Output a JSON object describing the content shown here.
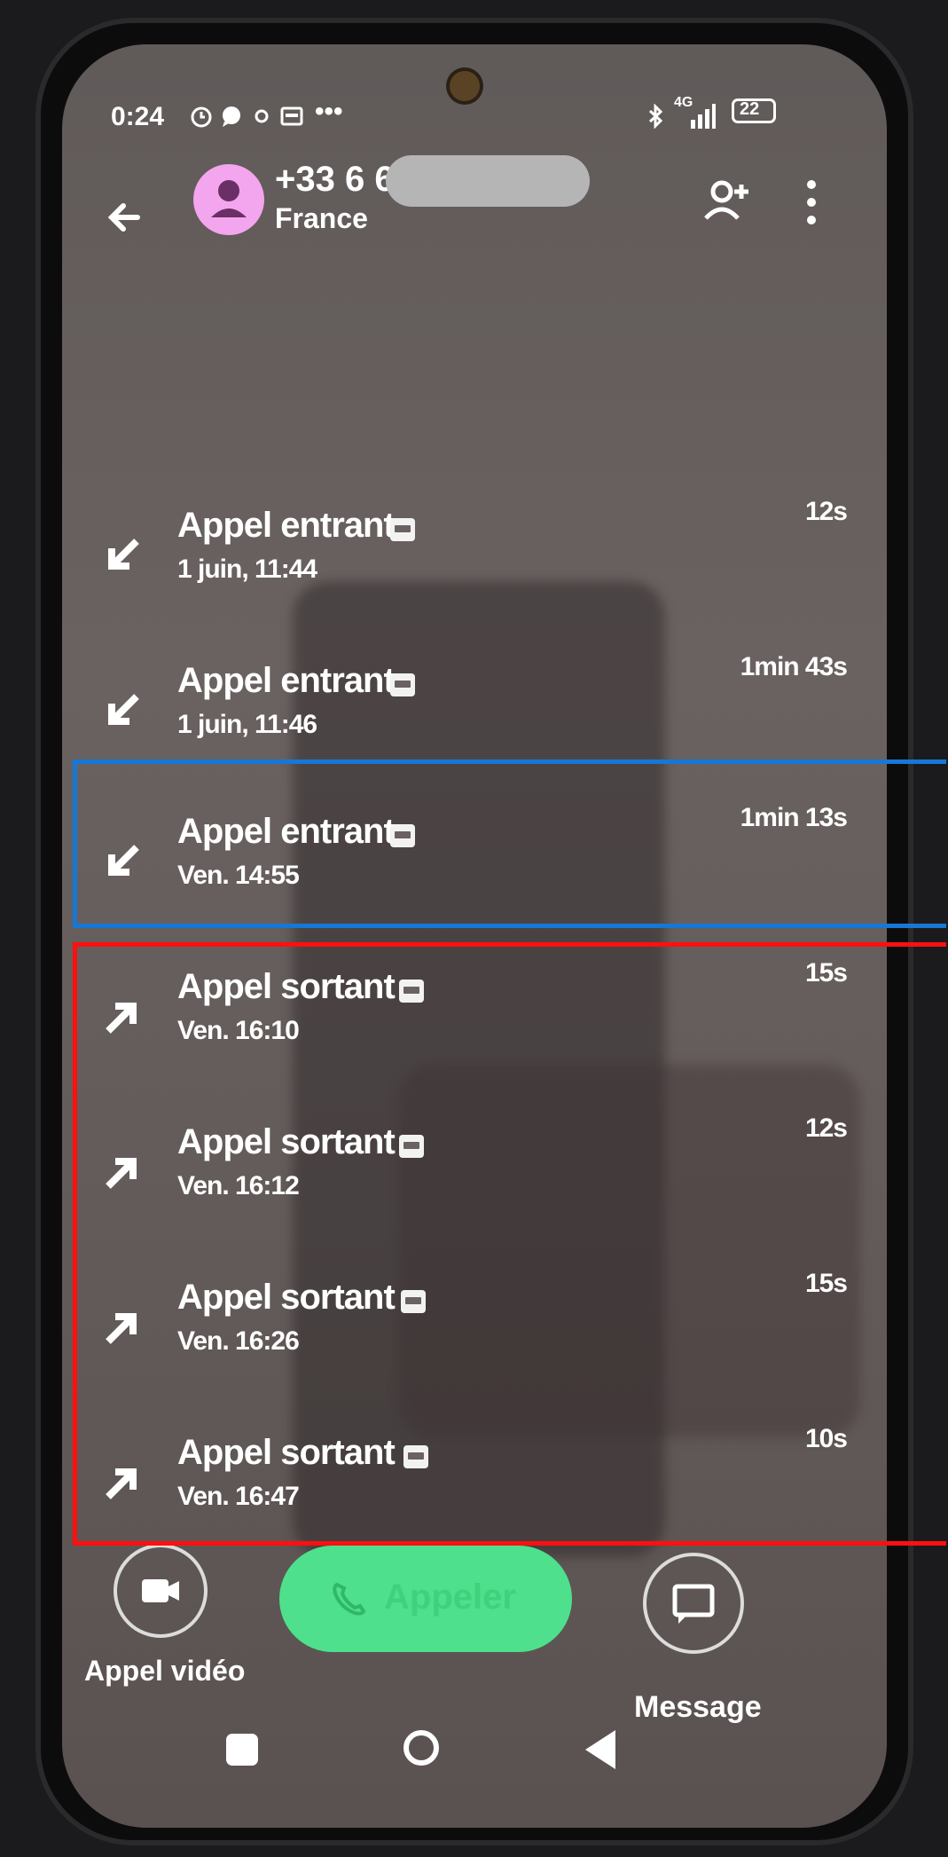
{
  "status_bar": {
    "time": "0:24",
    "extra": "•••",
    "network": "4G",
    "battery": "22"
  },
  "header": {
    "number": "+33 6 6",
    "country": "France"
  },
  "calls": [
    {
      "type": "Appel entrant",
      "time": "1 juin, 11:44",
      "duration": "12s",
      "direction": "incoming"
    },
    {
      "type": "Appel entrant",
      "time": "1 juin, 11:46",
      "duration": "1min 43s",
      "direction": "incoming"
    },
    {
      "type": "Appel entrant",
      "time": "Ven. 14:55",
      "duration": "1min 13s",
      "direction": "incoming"
    },
    {
      "type": "Appel sortant",
      "time": "Ven. 16:10",
      "duration": "15s",
      "direction": "outgoing"
    },
    {
      "type": "Appel sortant",
      "time": "Ven. 16:12",
      "duration": "12s",
      "direction": "outgoing"
    },
    {
      "type": "Appel sortant",
      "time": "Ven. 16:26",
      "duration": "15s",
      "direction": "outgoing"
    },
    {
      "type": "Appel sortant",
      "time": "Ven. 16:47",
      "duration": "10s",
      "direction": "outgoing"
    }
  ],
  "actions": {
    "video_call_label": "Appel vidéo",
    "call_label": "Appeler",
    "message_label": "Message"
  },
  "colors": {
    "call_button": "#4ee08c",
    "highlight_blue": "#1777d6",
    "highlight_red": "#ff1010",
    "avatar": "#f3a5ee"
  },
  "icons": {
    "incoming": "arrow-down-left-icon",
    "outgoing": "arrow-up-right-icon"
  }
}
